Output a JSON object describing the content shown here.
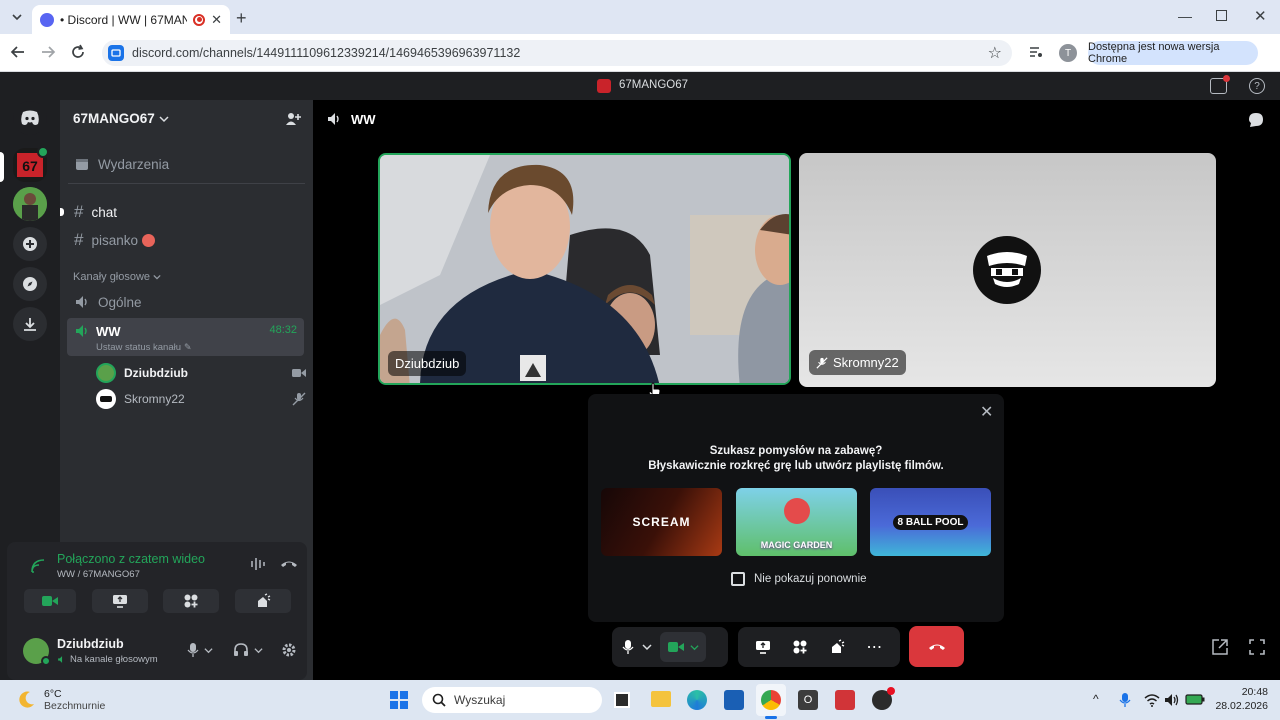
{
  "browser": {
    "tab_title": "• Discord | WW | 67MANGO",
    "url": "discord.com/channels/1449111109612339214/1469465396963971132",
    "update_notice": "Dostępna jest nowa wersja Chrome",
    "profile_initial": "T"
  },
  "discord": {
    "title_bar": "67MANGO67",
    "server_name": "67MANGO67",
    "events_label": "Wydarzenia",
    "text_channels": [
      "chat",
      "pisanko"
    ],
    "voice_category": "Kanały głosowe",
    "voice_channels": {
      "general": "Ogólne",
      "active": "WW",
      "timer": "48:32",
      "status_prompt": "Ustaw status kanału"
    },
    "voice_members": [
      "Dziubdziub",
      "Skromny22"
    ],
    "connection": {
      "title": "Połączono z czatem wideo",
      "subtitle": "WW / 67MANGO67"
    },
    "user": {
      "name": "Dziubdziub",
      "status": "Na kanale głosowym"
    },
    "channel_header": "WW",
    "tiles": {
      "left_name": "Dziubdziub",
      "right_name": "Skromny22"
    },
    "activity_popup": {
      "line1": "Szukasz pomysłów na zabawę?",
      "line2": "Błyskawicznie rozkręć grę lub utwórz playlistę filmów.",
      "games": [
        "SCREAM",
        "MAGIC GARDEN",
        "8 BALL POOL"
      ],
      "checkbox_label": "Nie pokazuj ponownie"
    }
  },
  "taskbar": {
    "weather_temp": "6°C",
    "weather_desc": "Bezchmurnie",
    "search_placeholder": "Wyszukaj",
    "time": "20:48",
    "date": "28.02.2026"
  },
  "colors": {
    "discord_green": "#23a55a",
    "hangup_red": "#da373c",
    "blurple": "#5865f2"
  }
}
